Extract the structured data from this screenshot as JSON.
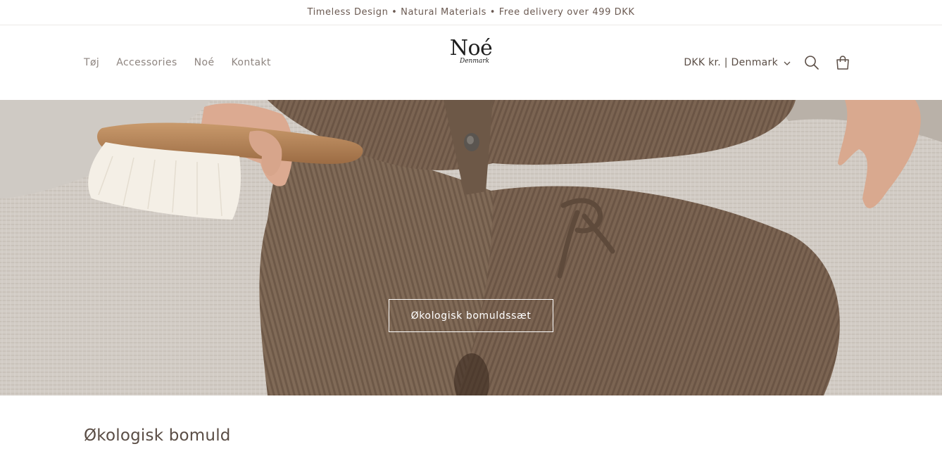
{
  "announcement": {
    "text": "Timeless Design • Natural Materials • Free delivery over 499 DKK"
  },
  "nav": {
    "items": [
      {
        "label": "Tøj"
      },
      {
        "label": "Accessories"
      },
      {
        "label": "Noé"
      },
      {
        "label": "Kontakt"
      }
    ]
  },
  "logo": {
    "main": "Noé",
    "sub": "Denmark"
  },
  "header": {
    "locale_label": "DKK kr. | Denmark",
    "icons": [
      "search-icon",
      "cart-icon",
      "chevron-down-icon"
    ]
  },
  "hero": {
    "cta_label": "Økologisk bomuldssæt",
    "image": "baby-in-knit-cotton-set-with-brush"
  },
  "section": {
    "title": "Økologisk bomuld"
  },
  "colors": {
    "text": "#5a4d45",
    "nav": "#8e8580",
    "knit": "#7a6250",
    "background": "#ffffff"
  }
}
